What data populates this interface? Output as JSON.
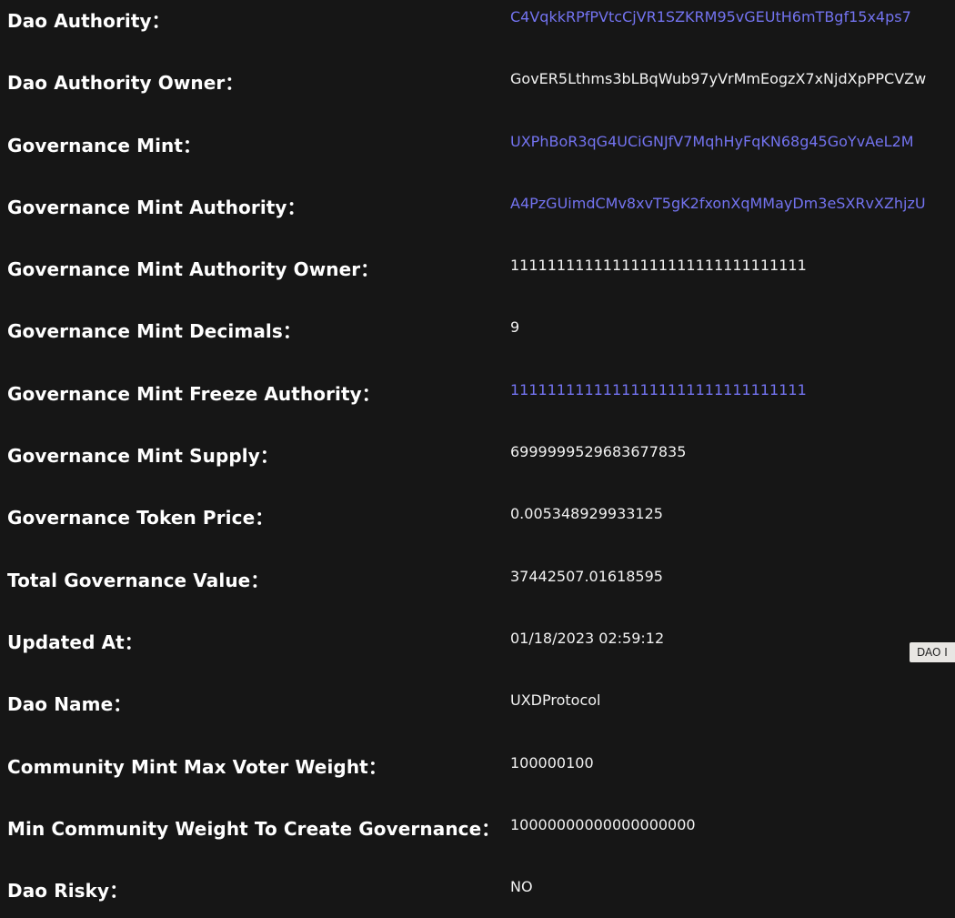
{
  "rows": [
    {
      "label": "Dao Authority：",
      "value": "C4VqkkRPfPVtcCjVR1SZKRM95vGEUtH6mTBgf15x4ps7",
      "link": true
    },
    {
      "label": "Dao Authority Owner：",
      "value": "GovER5Lthms3bLBqWub97yVrMmEogzX7xNjdXpPPCVZw",
      "link": false
    },
    {
      "label": "Governance Mint：",
      "value": "UXPhBoR3qG4UCiGNJfV7MqhHyFqKN68g45GoYvAeL2M",
      "link": true
    },
    {
      "label": "Governance Mint Authority：",
      "value": "A4PzGUimdCMv8xvT5gK2fxonXqMMayDm3eSXRvXZhjzU",
      "link": true
    },
    {
      "label": "Governance Mint Authority Owner：",
      "value": "11111111111111111111111111111111",
      "link": false
    },
    {
      "label": "Governance Mint Decimals：",
      "value": "9",
      "link": false
    },
    {
      "label": "Governance Mint Freeze Authority：",
      "value": "11111111111111111111111111111111",
      "link": true
    },
    {
      "label": "Governance Mint Supply：",
      "value": "6999999529683677835",
      "link": false
    },
    {
      "label": "Governance Token Price：",
      "value": "0.005348929933125",
      "link": false
    },
    {
      "label": "Total Governance Value：",
      "value": "37442507.01618595",
      "link": false
    },
    {
      "label": "Updated At：",
      "value": "01/18/2023 02:59:12",
      "link": false
    },
    {
      "label": "Dao Name：",
      "value": "UXDProtocol",
      "link": false
    },
    {
      "label": "Community Mint Max Voter Weight：",
      "value": "100000100",
      "link": false
    },
    {
      "label": "Min Community Weight To Create Governance：",
      "value": "10000000000000000000",
      "link": false
    },
    {
      "label": "Dao Risky：",
      "value": "NO",
      "link": false
    }
  ],
  "side_tab": {
    "label": "DAO I"
  },
  "colors": {
    "background": "#161616",
    "label_text": "#ffffff",
    "value_text": "#f2f2f2",
    "link_text": "#7373f0"
  }
}
